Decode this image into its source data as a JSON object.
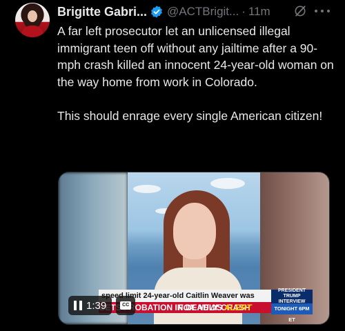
{
  "tweet": {
    "author_name": "Brigitte Gabri...",
    "handle": "@ACTBrigit...",
    "separator": "·",
    "time": "11m",
    "paragraphs": [
      "A far left prosecutor let an unlicensed illegal immigrant teen off without any jailtime after a 90-mph crash killed an innocent 24-year-old woman on the way home from work in Colorado.",
      "This should enrage every single American citizen!"
    ]
  },
  "icons": {
    "avatar": "avatar",
    "verified": "verified-badge-icon",
    "grok": "grok-icon",
    "more": "more-icon",
    "pause": "pause-icon",
    "captions": "captions-icon"
  },
  "media": {
    "ticker_line": "speed limit 24-year-old Caitlin Weaver was",
    "ticker_headline": "GETS PROBATION IN DEADLY CRASH",
    "network": "FOX NEWS",
    "alert": "ALERT",
    "promo_top": "PRESIDENT TRUMP INTERVIEW",
    "promo_bottom": "TONIGHT 6PM ET",
    "video_time": "1:39",
    "cc_label": "CC"
  },
  "colors": {
    "background": "#000000",
    "text": "#e7e9ea",
    "secondary": "#71767b",
    "verified": "#1d9bf0",
    "fox_red": "#c8102e",
    "alert_yellow": "#ffd400"
  }
}
